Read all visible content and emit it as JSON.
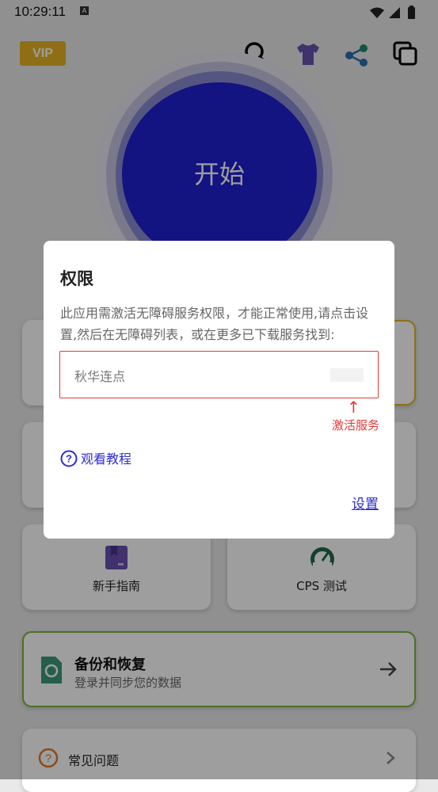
{
  "status_bar": {
    "time": "10:29:11",
    "notification_glyph": "A"
  },
  "app_bar": {
    "vip_label": "VIP",
    "icons": [
      "search-icon",
      "tshirt-icon",
      "share-icon",
      "copy-icon"
    ]
  },
  "start_button": {
    "label": "开始"
  },
  "cards": {
    "guide": {
      "label": "新手指南"
    },
    "cps": {
      "label": "CPS 测试"
    },
    "backup": {
      "title": "备份和恢复",
      "subtitle": "登录并同步您的数据"
    },
    "faq": {
      "label": "常见问题"
    }
  },
  "dialog": {
    "title": "权限",
    "message": "此应用需激活无障碍服务权限，才能正常使用,请点击设置,然后在无障碍列表，或在更多已下载服务找到:",
    "service_name": "秋华连点",
    "arrow": "↑",
    "activate_label": "激活服务",
    "tutorial_label": "观看教程",
    "settings_label": "设置"
  },
  "colors": {
    "accent_blue": "#2020d0",
    "link_blue": "#2c2cd0",
    "error_red": "#e53935",
    "vip_gold": "#e6b422",
    "backup_green": "#7cb342",
    "overlay_dim": "rgba(0,0,0,0.38)"
  }
}
